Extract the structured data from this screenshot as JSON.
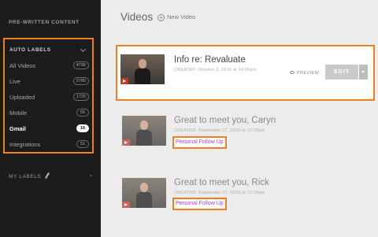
{
  "sidebar": {
    "prewritten_label": "PRE-WRITTEN CONTENT",
    "auto_labels": {
      "header": "AUTO LABELS",
      "items": [
        {
          "label": "All Videos",
          "count": "4796"
        },
        {
          "label": "Live",
          "count": "2780"
        },
        {
          "label": "Uploaded",
          "count": "1725"
        },
        {
          "label": "Mobile",
          "count": "65"
        },
        {
          "label": "Gmail",
          "count": "16"
        },
        {
          "label": "Integrations",
          "count": "51"
        }
      ]
    },
    "my_labels_label": "MY LABELS"
  },
  "main": {
    "title": "Videos",
    "new_video_label": "New Video",
    "videos": [
      {
        "title": "Info re: Revaluate",
        "created": "CREATED: October 3, 2016 at 10:55am",
        "preview_label": "PREVIEW",
        "edit_label": "EDIT"
      },
      {
        "title": "Great to meet you, Caryn",
        "created": "CREATED: September 27, 2016 at 12:29pm",
        "tag": "Personal Follow Up"
      },
      {
        "title": "Great to meet you, Rick",
        "created": "CREATED: September 27, 2016 at 12:26pm",
        "tag": "Personal Follow Up"
      }
    ]
  },
  "colors": {
    "highlight": "#f27d1b",
    "sidebar_bg": "#1c1c1c",
    "tag_text": "#a347c9"
  },
  "icons": [
    "chevron-down-icon",
    "pencil-icon",
    "plus-icon",
    "eye-icon",
    "play-icon",
    "caret-down-icon"
  ]
}
